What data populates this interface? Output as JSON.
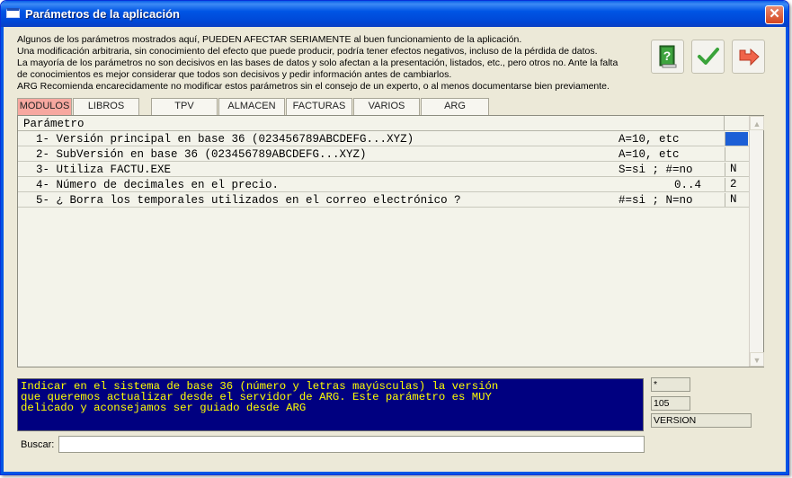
{
  "window": {
    "title": "Parámetros de la aplicación"
  },
  "info_lines": [
    "Algunos de los parámetros mostrados aquí, PUEDEN AFECTAR SERIAMENTE al buen funcionamiento de la aplicación.",
    "Una modificación arbitraria, sin conocimiento del efecto que puede producir, podría tener efectos negativos, incluso de la pérdida de datos.",
    "La mayoría de los parámetros no son decisivos en las bases de datos y solo afectan a la presentación, listados, etc., pero otros no. Ante la falta",
    "de conocimientos es mejor considerar que todos son decisivos y pedir información antes de cambiarlos.",
    "ARG Recomienda encarecidamente no modificar estos parámetros sin el consejo de un experto, o al menos documentarse bien previamente."
  ],
  "tabs": [
    {
      "label": "MODULOS",
      "active": true
    },
    {
      "label": "LIBROS"
    },
    {
      "label": "TPV"
    },
    {
      "label": "ALMACEN"
    },
    {
      "label": "FACTURAS"
    },
    {
      "label": "VARIOS"
    },
    {
      "label": "ARG"
    }
  ],
  "grid": {
    "header": "Parámetro",
    "rows": [
      {
        "desc": "1- Versión principal en base 36 (023456789ABCDEFG...XYZ)",
        "range": "A=10, etc",
        "value": "",
        "selected": true
      },
      {
        "desc": "2- SubVersión en base 36 (023456789ABCDEFG...XYZ)",
        "range": "A=10, etc",
        "value": ""
      },
      {
        "desc": "3- Utiliza FACTU.EXE",
        "range": "S=si ; #=no",
        "value": "N"
      },
      {
        "desc": "4- Número de decimales en el precio.",
        "range": "0..4",
        "value": "2"
      },
      {
        "desc": "5- ¿ Borra los temporales utilizados en el correo electrónico ?",
        "range": "#=si ; N=no",
        "value": "N"
      }
    ]
  },
  "description": "Indicar en el sistema de base 36 (número y letras mayúsculas) la versión\nque queremos actualizar desde el servidor de ARG. Este parámetro es MUY\ndelicado y aconsejamos ser guiado desde ARG",
  "fields": {
    "mask": "*",
    "number": "105",
    "name": "VERSION"
  },
  "search": {
    "label": "Buscar:",
    "value": ""
  },
  "colors": {
    "title_bar": "#0055e5",
    "active_tab": "#f7a8a0",
    "desc_bg": "#000080",
    "desc_text": "#ffff00",
    "selected_cell": "#1c5fd6"
  },
  "icons": [
    "help-book-icon",
    "checkmark-icon",
    "exit-arrow-icon",
    "close-icon",
    "window-icon"
  ]
}
